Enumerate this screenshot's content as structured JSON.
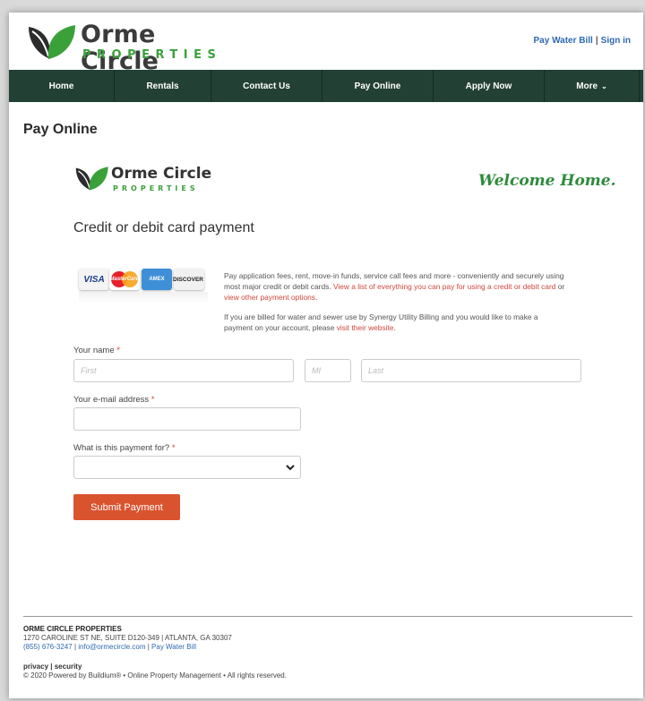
{
  "header": {
    "logo_name": "Orme Circle",
    "logo_sub": "PROPERTIES",
    "links": [
      "Pay Water Bill",
      "Sign in"
    ],
    "link_separator": "|"
  },
  "nav": {
    "items": [
      {
        "label": "Home"
      },
      {
        "label": "Rentals"
      },
      {
        "label": "Contact Us"
      },
      {
        "label": "Pay Online"
      },
      {
        "label": "Apply Now"
      },
      {
        "label": "More"
      }
    ]
  },
  "page_title": "Pay Online",
  "brand": {
    "name": "Orme Circle",
    "sub": "PROPERTIES",
    "welcome": "Welcome Home."
  },
  "form": {
    "heading": "Credit or debit card payment",
    "cards": [
      "VISA",
      "MasterCard",
      "AMEX",
      "DISCOVER"
    ],
    "desc_p1_text": "Pay application fees, rent, move-in funds, service call fees and more - conveniently and securely using most major credit or debit cards. ",
    "desc_p1_link1": "View a list of everything you can pay for using a credit or debit card",
    "desc_p1_or": " or ",
    "desc_p1_link2": "view other payment options",
    "desc_p1_end": ".",
    "desc_p2_text": "If you are billed for water and sewer use by Synergy Utility Billing and you would like to make a payment on your account, please ",
    "desc_p2_link": "visit their website",
    "desc_p2_end": ".",
    "name_label": "Your name",
    "required_mark": "*",
    "first_placeholder": "First",
    "mi_placeholder": "MI",
    "last_placeholder": "Last",
    "email_label": "Your e-mail address",
    "payment_for_label": "What is this payment for?",
    "payment_for_value": "",
    "submit_label": "Submit Payment"
  },
  "footer": {
    "company": "ORME CIRCLE PROPERTIES",
    "address": "1270 CAROLINE ST NE, SUITE D120-349 | ATLANTA, GA 30307",
    "phone": "(855) 676-3247",
    "email": "info@ormecircle.com",
    "pay_link": "Pay Water Bill",
    "sep": " | ",
    "privacy": "privacy",
    "security": "security",
    "copyright": "© 2020 Powered by Buildium® • Online Property Management • All rights reserved."
  },
  "colors": {
    "nav_bg": "#234034",
    "brand_green": "#3aa13a",
    "link_blue": "#2d6ab0",
    "accent_orange": "#d9532f"
  }
}
